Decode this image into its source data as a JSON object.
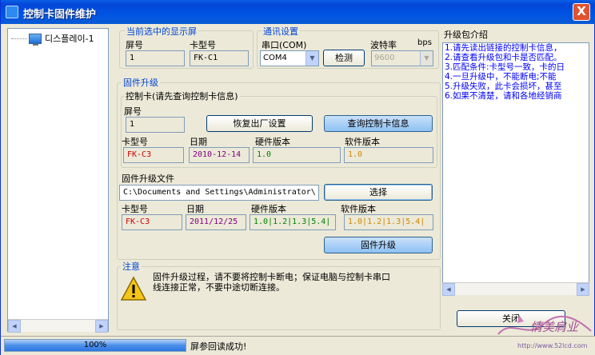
{
  "window": {
    "title": "控制卡固件维护",
    "close_glyph": "X"
  },
  "tree": {
    "items": [
      {
        "label": "디스플레이-1"
      }
    ],
    "scroll_left": "◀",
    "scroll_right": "▶"
  },
  "current_screen": {
    "group_label": "当前选中的显示屏",
    "screen_no_label": "屏号",
    "screen_no": "1",
    "card_model_label": "卡型号",
    "card_model": "FK-C1"
  },
  "comm": {
    "group_label": "通讯设置",
    "port_label": "串口(COM)",
    "port_value": "COM4",
    "detect_button": "检测",
    "baud_label": "波特率",
    "baud_unit": "bps",
    "baud_value": "9600"
  },
  "firmware_upgrade": {
    "group_label": "固件升级",
    "card_group_label": "控制卡(请先查询控制卡信息)",
    "screen_no_label": "屏号",
    "screen_no": "1",
    "factory_reset_button": "恢复出厂设置",
    "query_button": "查询控制卡信息",
    "card_model_label": "卡型号",
    "card_model": "FK-C3",
    "date_label": "日期",
    "date": "2010-12-14",
    "hw_version_label": "硬件版本",
    "hw_version": "1.0",
    "sw_version_label": "软件版本",
    "sw_version": "1.0",
    "file_label": "固件升级文件",
    "file_path": "C:\\Documents and Settings\\Administrator\\",
    "select_button": "选择",
    "file_card_model_label": "卡型号",
    "file_card_model": "FK-C3",
    "file_date_label": "日期",
    "file_date": "2011/12/25",
    "file_hw_label": "硬件版本",
    "file_hw": "1.0|1.2|1.3|5.4|",
    "file_sw_label": "软件版本",
    "file_sw": "1.0|1.2|1.3|5.4|",
    "upgrade_button": "固件升级"
  },
  "notice": {
    "group_label": "注意",
    "text_line1": "固件升级过程，请不要将控制卡断电；保证电脑与控制卡串口",
    "text_line2": "线连接正常，不要中途切断连接。"
  },
  "package_intro": {
    "label": "升级包介绍",
    "lines": [
      "1.请先读出链接的控制卡信息，",
      "2.请查看升级包和卡是否匹配。",
      "3.匹配条件:卡型号一致，卡的日",
      "4.一旦升级中，不能断电;不能",
      "5.升级失败，此卡会损坏，甚至",
      "6.如果不清楚，请和各地经销商"
    ],
    "scroll_left": "◀",
    "scroll_right": "▶"
  },
  "close_button": "关闭",
  "status": {
    "progress_text": "100%",
    "progress": 1.0,
    "message": "屏参回读成功!"
  },
  "watermark": {
    "text": "情美肩业",
    "url": "http://www.52lcd.com"
  },
  "colors": {
    "title_bar": "#0054e3",
    "group_label": "#0046d5",
    "card_model_text": "#cc0000",
    "date_text": "#800080",
    "hw_text": "#008000",
    "sw_text": "#cc8800",
    "intro_text": "#0000ff"
  }
}
